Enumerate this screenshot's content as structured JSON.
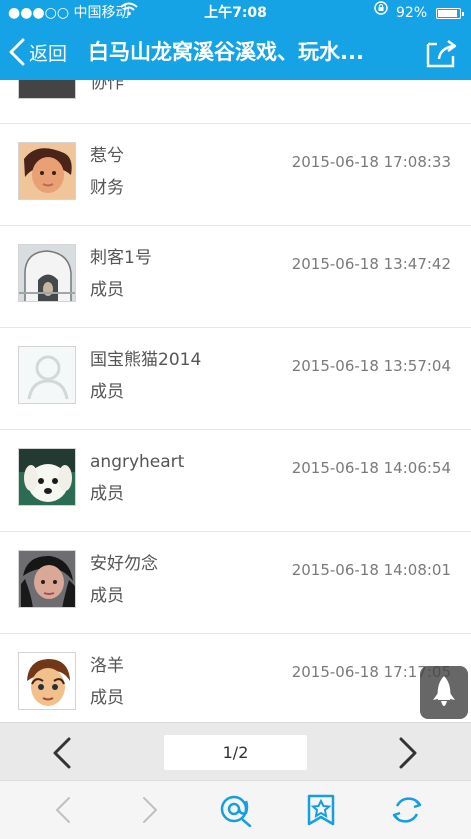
{
  "status_bar": {
    "carrier": "●●●○○ 中国移动",
    "time": "上午7:08",
    "battery": "92%",
    "battery_level": 0.92
  },
  "nav": {
    "back_label": "返回",
    "title": "白马山龙窝溪谷溪戏、玩水...",
    "back_icon": "chevron-left-icon",
    "share_icon": "share-icon"
  },
  "members": {
    "partial_role": "协作",
    "items": [
      {
        "name": "惹兮",
        "role": "财务",
        "date": "2015-06-18 17:08:33"
      },
      {
        "name": "刺客1号",
        "role": "成员",
        "date": "2015-06-18 13:47:42"
      },
      {
        "name": "国宝熊猫2014",
        "role": "成员",
        "date": "2015-06-18 13:57:04"
      },
      {
        "name": "angryheart",
        "role": "成员",
        "date": "2015-06-18 14:06:54"
      },
      {
        "name": "安好勿念",
        "role": "成员",
        "date": "2015-06-18 14:08:01"
      },
      {
        "name": "洛羊",
        "role": "成员",
        "date": "2015-06-18 17:17:05"
      }
    ]
  },
  "pager": {
    "page_text": "1/2"
  },
  "toolbar": {
    "icons": [
      "back-icon",
      "forward-icon",
      "mention-icon",
      "favorite-icon",
      "refresh-icon"
    ]
  },
  "colors": {
    "header": "#16a3e5",
    "accent_icon": "#159fe0",
    "text": "#555555",
    "date": "#7a7a7a"
  }
}
